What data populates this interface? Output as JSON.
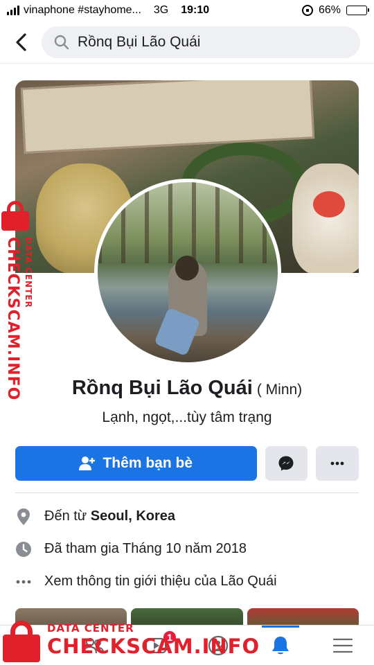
{
  "status_bar": {
    "carrier": "vinaphone #stayhome...",
    "network": "3G",
    "time": "19:10",
    "battery_percent": "66%",
    "battery_level": 0.66
  },
  "search": {
    "query": "Rồnq Bụi Lão Quái"
  },
  "profile": {
    "name": "Rồnq Bụi Lão Quái",
    "alternate_name": "( Minn)",
    "bio": "Lạnh, ngọt,...tùy tâm trạng",
    "add_friend_label": "Thêm bạn bè"
  },
  "details": {
    "lives_prefix": "Đến từ ",
    "lives_place": "Seoul, Korea",
    "joined": "Đã tham gia Tháng 10 năm 2018",
    "about": "Xem thông tin giới thiệu của Lão Quái"
  },
  "bottom_nav": {
    "watch_badge": "1"
  },
  "watermark": {
    "side_small": "DATA CENTER",
    "side_big": "CHECKSCAM.INFO",
    "bottom_small": "DATA CENTER",
    "bottom_big": "CHECKSCAM.INFO"
  },
  "colors": {
    "primary": "#1b74e4",
    "watermark": "#e0202a",
    "badge": "#e41e3f"
  }
}
